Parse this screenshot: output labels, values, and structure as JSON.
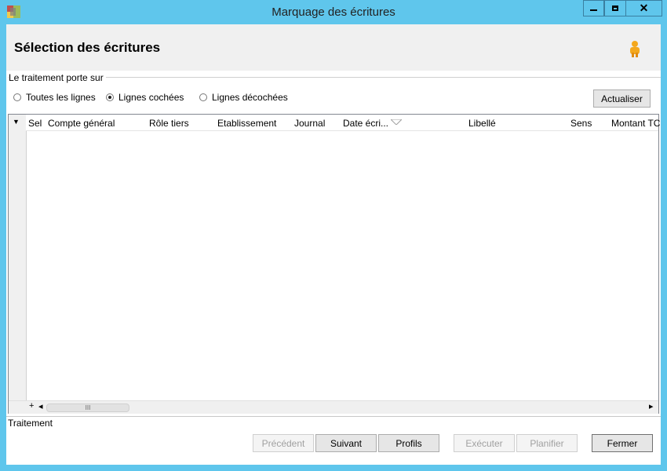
{
  "window": {
    "title": "Marquage des écritures",
    "minimize_glyph": "▬",
    "maximize_glyph": "▢",
    "close_glyph": "✕"
  },
  "header": {
    "title": "Sélection des écritures",
    "user_icon": "user-icon"
  },
  "filter_group": {
    "label": "Le traitement porte sur",
    "options": [
      {
        "label": "Toutes les lignes",
        "selected": false
      },
      {
        "label": "Lignes cochées",
        "selected": true
      },
      {
        "label": "Lignes décochées",
        "selected": false
      }
    ],
    "refresh_button": "Actualiser"
  },
  "grid": {
    "columns": [
      "Sel",
      "Compte général",
      "Rôle tiers",
      "Etablissement",
      "Journal",
      "Date écri...",
      "Libellé",
      "Sens",
      "Montant TC"
    ],
    "rows": [],
    "expand_glyph": "+",
    "scroll_thumb_glyph": "III",
    "scroll_left_glyph": "◂",
    "scroll_right_glyph": "▸",
    "rowheader_glyph": "▼"
  },
  "treatment_group": {
    "label": "Traitement"
  },
  "footer": {
    "previous": "Précédent",
    "next": "Suivant",
    "profiles": "Profils",
    "execute": "Exécuter",
    "schedule": "Planifier",
    "close": "Fermer"
  }
}
